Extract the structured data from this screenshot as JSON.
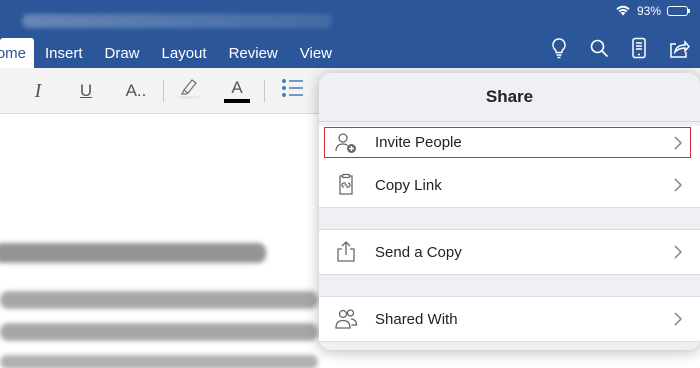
{
  "status": {
    "battery_text": "93%",
    "icons": [
      "wifi-icon",
      "battery-icon"
    ]
  },
  "ribbon": {
    "tabs": [
      {
        "label": "Home",
        "visible_label": "ome",
        "active": true
      },
      {
        "label": "Insert"
      },
      {
        "label": "Draw"
      },
      {
        "label": "Layout"
      },
      {
        "label": "Review"
      },
      {
        "label": "View"
      }
    ],
    "right_icons": [
      "lightbulb-icon",
      "search-icon",
      "mobile-view-icon",
      "share-icon"
    ]
  },
  "toolbar": {
    "italic": "I",
    "underline": "U",
    "text_effects": "A..",
    "font_color": "A"
  },
  "share": {
    "title": "Share",
    "items": [
      {
        "label": "Invite People",
        "icon": "invite-people-icon"
      },
      {
        "label": "Copy Link",
        "icon": "copy-link-icon"
      },
      {
        "label": "Send a Copy",
        "icon": "send-copy-icon"
      },
      {
        "label": "Shared With",
        "icon": "shared-with-icon"
      }
    ]
  },
  "colors": {
    "ribbon_blue": "#2b579a",
    "highlight_red": "#d12d34",
    "popover_bg": "#efeff4"
  }
}
